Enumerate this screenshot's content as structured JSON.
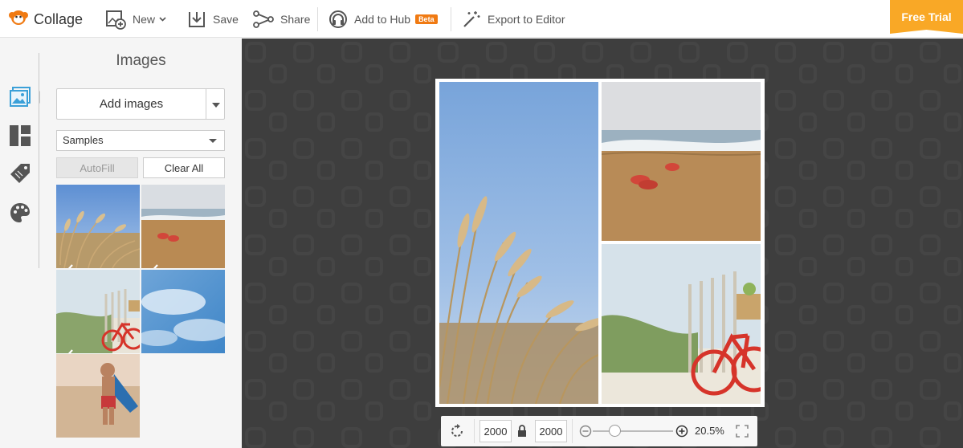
{
  "app": {
    "name": "Collage"
  },
  "toolbar": {
    "new_label": "New",
    "save_label": "Save",
    "share_label": "Share",
    "hub_label": "Add to Hub",
    "hub_badge": "Beta",
    "export_label": "Export to Editor",
    "free_trial_label": "Free Trial"
  },
  "colors": {
    "accent": "#f07a12",
    "trial": "#f9a826",
    "canvas_bg": "#3e3e3e",
    "sidebar_active": "#3ba0d8"
  },
  "sidebar": {
    "items": [
      {
        "icon": "image-icon",
        "active": true
      },
      {
        "icon": "layout-icon",
        "active": false
      },
      {
        "icon": "sticker-tag-icon",
        "active": false
      },
      {
        "icon": "palette-icon",
        "active": false
      }
    ]
  },
  "panel": {
    "title": "Images",
    "add_images_label": "Add images",
    "source_selected": "Samples",
    "autofill_label": "AutoFill",
    "clear_all_label": "Clear All",
    "thumbnails": [
      {
        "subject": "beach grass",
        "used": true
      },
      {
        "subject": "sandals on beach",
        "used": true
      },
      {
        "subject": "red bicycle on dune",
        "used": true
      },
      {
        "subject": "clouds in sky",
        "used": false
      },
      {
        "subject": "boy with cape on beach",
        "used": false
      }
    ]
  },
  "zoombar": {
    "width_value": "2000",
    "height_value": "2000",
    "zoom_label": "20.5%",
    "zoom_level": 0.27
  }
}
